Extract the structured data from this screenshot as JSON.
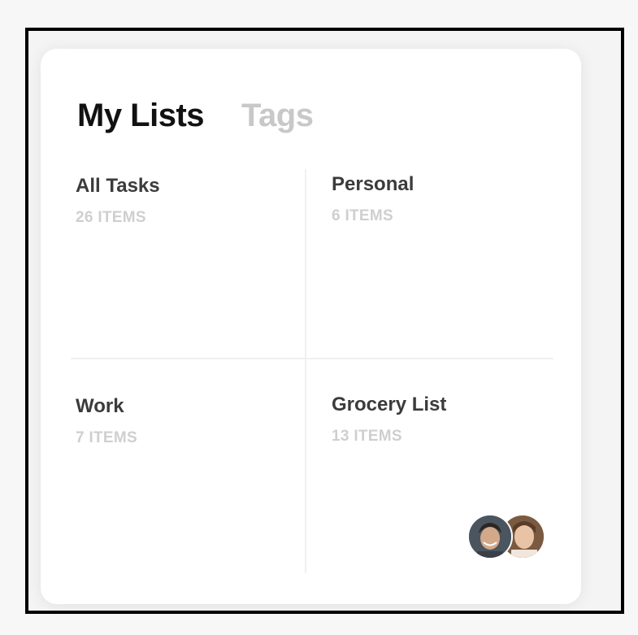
{
  "tabs": [
    {
      "label": "My Lists"
    },
    {
      "label": "Tags"
    }
  ],
  "lists": [
    {
      "title": "All Tasks",
      "count": "26 ITEMS"
    },
    {
      "title": "Personal",
      "count": "6 ITEMS"
    },
    {
      "title": "Work",
      "count": "7 ITEMS"
    },
    {
      "title": "Grocery List",
      "count": "13 ITEMS"
    }
  ],
  "shared_with": [
    "user-avatar",
    "user-avatar"
  ],
  "colors": {
    "accent_text": "#111111",
    "inactive_tab": "#c8c8c8",
    "title_text": "#3b3b3b",
    "count_text": "#cfcfcf"
  }
}
